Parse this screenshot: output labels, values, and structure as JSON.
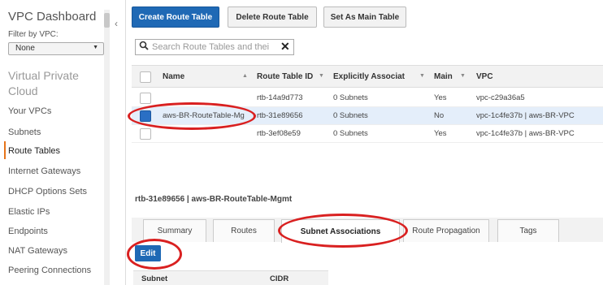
{
  "sidebar": {
    "title": "VPC Dashboard",
    "filter_label": "Filter by VPC:",
    "filter_value": "None",
    "section": "Virtual Private Cloud",
    "items": [
      {
        "label": "Your VPCs"
      },
      {
        "label": "Subnets"
      },
      {
        "label": "Route Tables",
        "active": true
      },
      {
        "label": "Internet Gateways"
      },
      {
        "label": "DHCP Options Sets"
      },
      {
        "label": "Elastic IPs"
      },
      {
        "label": "Endpoints"
      },
      {
        "label": "NAT Gateways"
      },
      {
        "label": "Peering Connections"
      }
    ]
  },
  "toolbar": {
    "create_label": "Create Route Table",
    "delete_label": "Delete Route Table",
    "set_main_label": "Set As Main Table"
  },
  "search": {
    "placeholder": "Search Route Tables and thei",
    "clear_glyph": "✕"
  },
  "table": {
    "columns": [
      "Name",
      "Route Table ID",
      "Explicitly Associat",
      "Main",
      "VPC"
    ],
    "rows": [
      {
        "name": "",
        "id": "rtb-14a9d773",
        "assoc": "0 Subnets",
        "main": "Yes",
        "vpc": "vpc-c29a36a5",
        "selected": false
      },
      {
        "name": "aws-BR-RouteTable-Mg",
        "id": "rtb-31e89656",
        "assoc": "0 Subnets",
        "main": "No",
        "vpc": "vpc-1c4fe37b | aws-BR-VPC",
        "selected": true
      },
      {
        "name": "",
        "id": "rtb-3ef08e59",
        "assoc": "0 Subnets",
        "main": "Yes",
        "vpc": "vpc-1c4fe37b | aws-BR-VPC",
        "selected": false
      }
    ]
  },
  "details": {
    "title": "rtb-31e89656 | aws-BR-RouteTable-Mgmt",
    "tabs": [
      "Summary",
      "Routes",
      "Subnet Associations",
      "Route Propagation",
      "Tags"
    ],
    "active_tab": "Subnet Associations",
    "edit_label": "Edit",
    "columns": [
      "Subnet",
      "CIDR"
    ]
  },
  "colors": {
    "primary": "#1f69b5",
    "annotation": "#d92020",
    "active_nav": "#e6741a"
  }
}
